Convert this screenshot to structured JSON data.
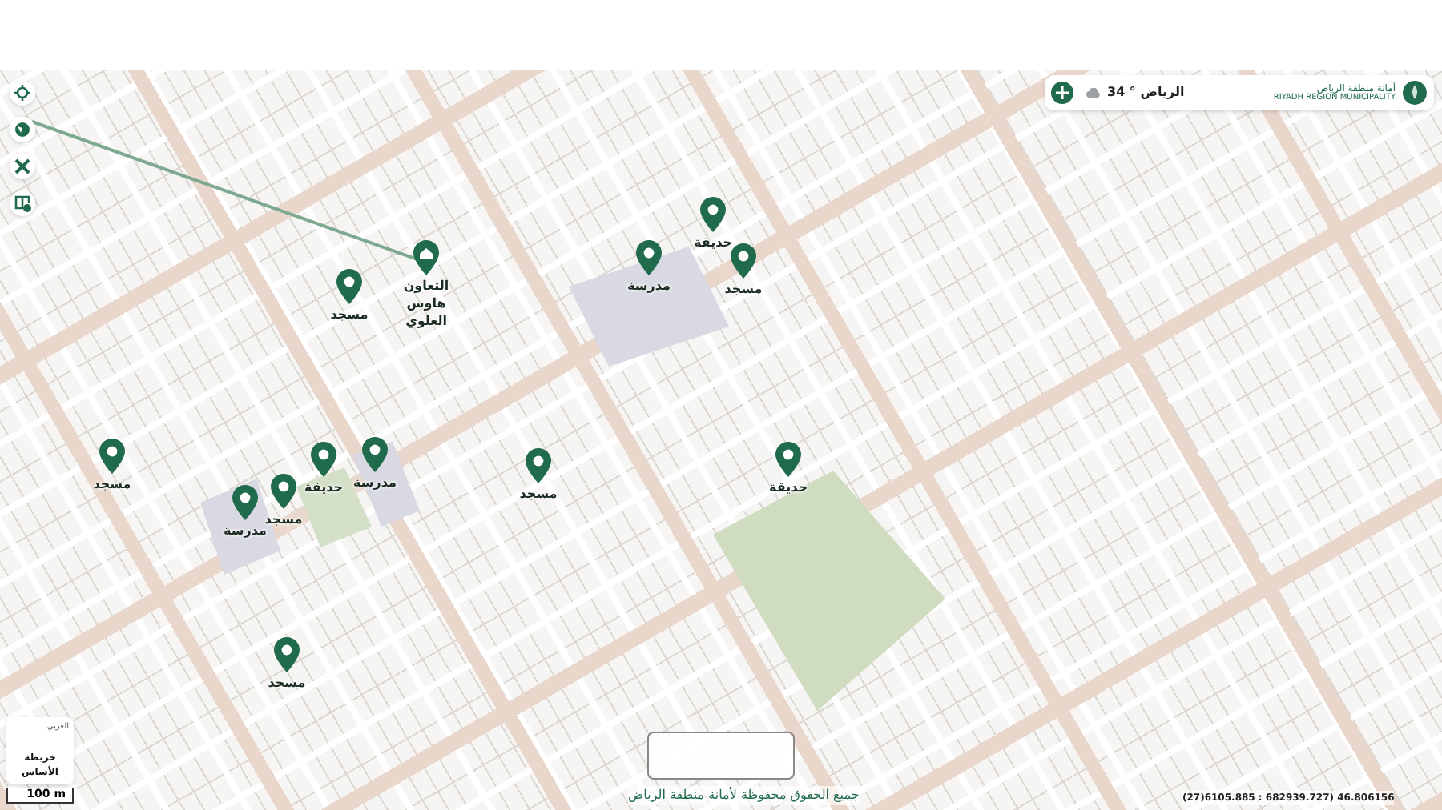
{
  "search_bar": {
    "org_name": "أمانة منطقة الرياض",
    "org_subtitle": "RIYADH REGION MUNICIPALITY",
    "weather": "الرياض ° 34"
  },
  "pins": [
    {
      "label": "حديقة",
      "kind": "plain"
    },
    {
      "label": "مسجد",
      "kind": "plain"
    },
    {
      "label": "مدرسة",
      "kind": "plain"
    },
    {
      "label": "التعاون هاوس العلوي",
      "kind": "house"
    },
    {
      "label": "مسجد",
      "kind": "plain"
    },
    {
      "label": "حديقة",
      "kind": "plain"
    },
    {
      "label": "مسجد",
      "kind": "plain"
    },
    {
      "label": "مدرسة",
      "kind": "plain"
    },
    {
      "label": "حديقة",
      "kind": "plain"
    },
    {
      "label": "مسجد",
      "kind": "plain"
    },
    {
      "label": "مدرسة",
      "kind": "plain"
    },
    {
      "label": "مسجد",
      "kind": "plain"
    },
    {
      "label": "مسجد",
      "kind": "plain"
    }
  ],
  "basemap": {
    "language": "العربي",
    "label": "خريطة الأساس"
  },
  "scale": "100 m",
  "copyright": "جميع الحقوق محفوظة لأمانة منطقة الرياض",
  "coordinates": "(27)6105.885 : 682939.727) 46.806156"
}
